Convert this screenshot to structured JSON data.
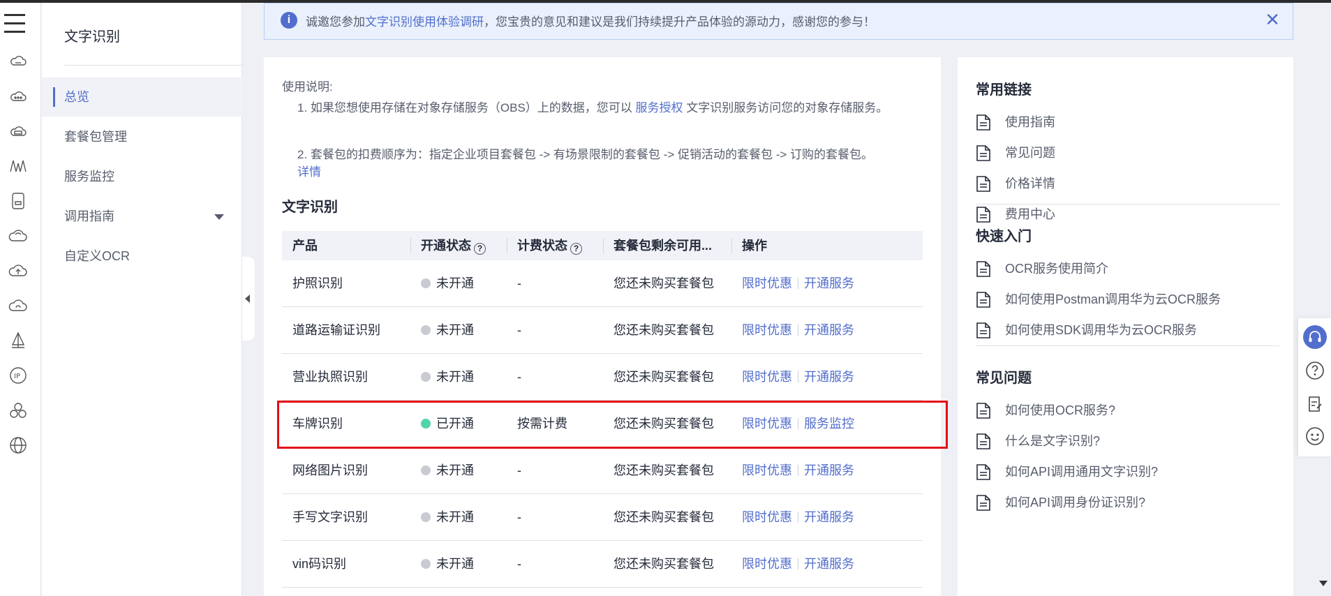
{
  "sidebar": {
    "title": "文字识别",
    "items": [
      {
        "label": "总览"
      },
      {
        "label": "套餐包管理"
      },
      {
        "label": "服务监控"
      },
      {
        "label": "调用指南"
      },
      {
        "label": "自定义OCR"
      }
    ]
  },
  "notice": {
    "prefix": "诚邀您参加",
    "link": "文字识别使用体验调研",
    "suffix": "，您宝贵的意见和建议是我们持续提升产品体验的源动力，感谢您的参与！",
    "close": "✕"
  },
  "usage": {
    "heading": "使用说明:",
    "line1_prefix": "1. 如果您想使用存储在对象存储服务（OBS）上的数据，您可以",
    "line1_link": "服务授权",
    "line1_suffix": " 文字识别服务访问您的对象存储服务。",
    "line2": "2. 套餐包的扣费顺序为：指定企业项目套餐包 -> 有场景限制的套餐包 -> 促销活动的套餐包 -> 订购的套餐包。",
    "line2_link": "详情"
  },
  "section_title": "文字识别",
  "table": {
    "headers": [
      "产品",
      "开通状态",
      "计费状态",
      "套餐包剩余可用...",
      "操作"
    ],
    "rows": [
      {
        "product": "护照识别",
        "status": "未开通",
        "billing": "-",
        "package": "您还未购买套餐包",
        "action1": "限时优惠",
        "action2": "开通服务",
        "active": false
      },
      {
        "product": "道路运输证识别",
        "status": "未开通",
        "billing": "-",
        "package": "您还未购买套餐包",
        "action1": "限时优惠",
        "action2": "开通服务",
        "active": false
      },
      {
        "product": "营业执照识别",
        "status": "未开通",
        "billing": "-",
        "package": "您还未购买套餐包",
        "action1": "限时优惠",
        "action2": "开通服务",
        "active": false
      },
      {
        "product": "车牌识别",
        "status": "已开通",
        "billing": "按需计费",
        "package": "您还未购买套餐包",
        "action1": "限时优惠",
        "action2": "服务监控",
        "active": true
      },
      {
        "product": "网络图片识别",
        "status": "未开通",
        "billing": "-",
        "package": "您还未购买套餐包",
        "action1": "限时优惠",
        "action2": "开通服务",
        "active": false
      },
      {
        "product": "手写文字识别",
        "status": "未开通",
        "billing": "-",
        "package": "您还未购买套餐包",
        "action1": "限时优惠",
        "action2": "开通服务",
        "active": false
      },
      {
        "product": "vin码识别",
        "status": "未开通",
        "billing": "-",
        "package": "您还未购买套餐包",
        "action1": "限时优惠",
        "action2": "开通服务",
        "active": false
      }
    ]
  },
  "right": {
    "common_links": {
      "title": "常用链接",
      "items": [
        "使用指南",
        "常见问题",
        "价格详情",
        "费用中心"
      ]
    },
    "quick_start": {
      "title": "快速入门",
      "items": [
        "OCR服务使用简介",
        "如何使用Postman调用华为云OCR服务",
        "如何使用SDK调用华为云OCR服务"
      ]
    },
    "faq": {
      "title": "常见问题",
      "items": [
        "如何使用OCR服务?",
        "什么是文字识别?",
        "如何API调用通用文字识别?",
        "如何API调用身份证识别?"
      ]
    }
  },
  "colors": {
    "accent": "#526ecc",
    "active_dot": "#50d4ab",
    "inactive_dot": "#c8cbd2",
    "highlight": "#e30d17"
  },
  "icons": {
    "rail": [
      "cloud-server-icon",
      "cloud-icon",
      "cloud-network-icon",
      "waveform-icon",
      "device-icon",
      "cloud-outline-icon",
      "cloud-upload-icon",
      "cloud-sync-icon",
      "sailboat-icon",
      "ip-icon",
      "cluster-icon",
      "globe-icon"
    ],
    "float": [
      "headset-icon",
      "help-icon",
      "feedback-icon",
      "smile-icon"
    ]
  }
}
